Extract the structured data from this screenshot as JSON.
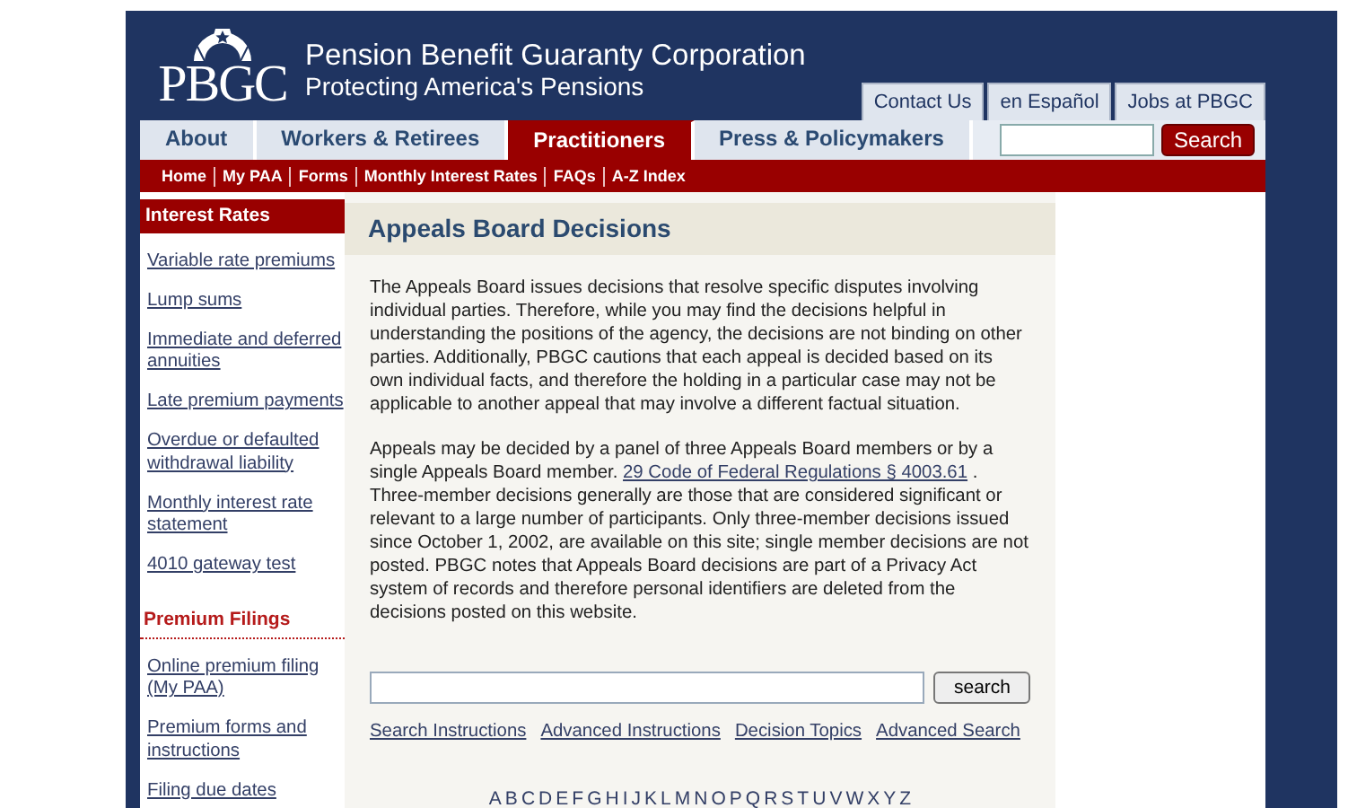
{
  "header": {
    "logo_text": "PBGC",
    "title": "Pension Benefit Guaranty Corporation",
    "subtitle": "Protecting America's Pensions",
    "top_links": [
      "Contact Us",
      "en Español",
      "Jobs at PBGC"
    ]
  },
  "tabs": [
    {
      "label": "About",
      "selected": false
    },
    {
      "label": "Workers & Retirees",
      "selected": false
    },
    {
      "label": "Practitioners",
      "selected": true
    },
    {
      "label": "Press & Policymakers",
      "selected": false
    }
  ],
  "site_search": {
    "button": "Search"
  },
  "subnav": [
    "Home",
    "My PAA",
    "Forms",
    "Monthly Interest Rates",
    "FAQs",
    "A-Z Index"
  ],
  "sidebar": {
    "sections": [
      {
        "heading": "Interest Rates",
        "kind": "bar",
        "items": [
          "Variable rate premiums",
          "Lump sums",
          "Immediate and deferred annuities",
          "Late premium payments",
          "Overdue or defaulted withdrawal liability",
          "Monthly interest rate statement",
          "4010 gateway test"
        ]
      },
      {
        "heading": "Premium Filings",
        "kind": "plain",
        "items": [
          "Online premium filing (My PAA)",
          "Premium forms and instructions",
          "Filing due dates"
        ]
      }
    ]
  },
  "main": {
    "heading": "Appeals Board Decisions",
    "paragraphs": [
      {
        "segments": [
          {
            "kind": "text",
            "text": "The Appeals Board issues decisions that resolve specific disputes involving individual  parties.  Therefore, while you may find the decisions helpful in understanding the positions of the agency, the decisions are not binding on other parties.  Additionally, PBGC cautions that each appeal is decided based on its own individual facts, and therefore the holding in a particular case may not be applicable to another appeal that may involve a different factual situation."
          }
        ]
      },
      {
        "segments": [
          {
            "kind": "text",
            "text": "Appeals may be decided by a panel of three Appeals Board members or by a single Appeals Board member.  "
          },
          {
            "kind": "link",
            "text": "29 Code of Federal Regulations § 4003.61"
          },
          {
            "kind": "text",
            "text": " . Three-member decisions generally are those that are considered significant or relevant to a large number of participants.  Only three-member decisions issued since October 1, 2002, are available on this site;  single member decisions are not posted.  PBGC notes that Appeals Board decisions are part of a Privacy Act system of records and therefore personal identifiers are deleted from the decisions posted on this website."
          }
        ]
      }
    ],
    "search_button": "search",
    "links": [
      "Search Instructions",
      "Advanced Instructions",
      "Decision Topics",
      "Advanced Search"
    ],
    "letters": [
      "A",
      "B",
      "C",
      "D",
      "E",
      "F",
      "G",
      "H",
      "I",
      "J",
      "K",
      "L",
      "M",
      "N",
      "O",
      "P",
      "Q",
      "R",
      "S",
      "T",
      "U",
      "V",
      "W",
      "X",
      "Y",
      "Z"
    ]
  }
}
